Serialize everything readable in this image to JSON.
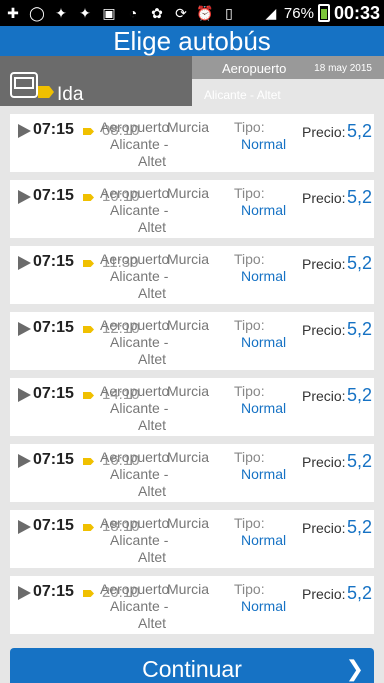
{
  "status_bar": {
    "battery_percent": "76%",
    "clock": "00:33",
    "icons": [
      "plus-icon",
      "whatsapp-icon",
      "twitter-icon",
      "twitter-icon",
      "image-icon",
      "wifi-icon",
      "settings-icon",
      "sync-icon",
      "alarm-icon",
      "vibrate-icon",
      "signal-icon",
      "battery-icon"
    ]
  },
  "title": "Elige autobús",
  "header": {
    "direction_label": "Ida",
    "origin": "Aeropuerto",
    "date": "18 may 2015",
    "destination": "Alicante - Altet"
  },
  "trips": [
    {
      "time": "07:15",
      "arrival": "08:10",
      "origin_l1": "Aeropuerto",
      "origin_l2": "Alicante -",
      "origin_l3": "Altet",
      "destination": "Murcia",
      "tipo_label": "Tipo:",
      "tipo_value": "Normal",
      "precio_label": "Precio:",
      "precio_value": "5,2"
    },
    {
      "time": "07:15",
      "arrival": "10:10",
      "origin_l1": "Aeropuerto",
      "origin_l2": "Alicante -",
      "origin_l3": "Altet",
      "destination": "Murcia",
      "tipo_label": "Tipo:",
      "tipo_value": "Normal",
      "precio_label": "Precio:",
      "precio_value": "5,2"
    },
    {
      "time": "07:15",
      "arrival": "11:30",
      "origin_l1": "Aeropuerto",
      "origin_l2": "Alicante -",
      "origin_l3": "Altet",
      "destination": "Murcia",
      "tipo_label": "Tipo:",
      "tipo_value": "Normal",
      "precio_label": "Precio:",
      "precio_value": "5,2"
    },
    {
      "time": "07:15",
      "arrival": "12:10",
      "origin_l1": "Aeropuerto",
      "origin_l2": "Alicante -",
      "origin_l3": "Altet",
      "destination": "Murcia",
      "tipo_label": "Tipo:",
      "tipo_value": "Normal",
      "precio_label": "Precio:",
      "precio_value": "5,2"
    },
    {
      "time": "07:15",
      "arrival": "14:10",
      "origin_l1": "Aeropuerto",
      "origin_l2": "Alicante -",
      "origin_l3": "Altet",
      "destination": "Murcia",
      "tipo_label": "Tipo:",
      "tipo_value": "Normal",
      "precio_label": "Precio:",
      "precio_value": "5,2"
    },
    {
      "time": "07:15",
      "arrival": "16:10",
      "origin_l1": "Aeropuerto",
      "origin_l2": "Alicante -",
      "origin_l3": "Altet",
      "destination": "Murcia",
      "tipo_label": "Tipo:",
      "tipo_value": "Normal",
      "precio_label": "Precio:",
      "precio_value": "5,2"
    },
    {
      "time": "07:15",
      "arrival": "18:10",
      "origin_l1": "Aeropuerto",
      "origin_l2": "Alicante -",
      "origin_l3": "Altet",
      "destination": "Murcia",
      "tipo_label": "Tipo:",
      "tipo_value": "Normal",
      "precio_label": "Precio:",
      "precio_value": "5,2"
    },
    {
      "time": "07:15",
      "arrival": "20:10",
      "origin_l1": "Aeropuerto",
      "origin_l2": "Alicante -",
      "origin_l3": "Altet",
      "destination": "Murcia",
      "tipo_label": "Tipo:",
      "tipo_value": "Normal",
      "precio_label": "Precio:",
      "precio_value": "5,2"
    }
  ],
  "continue_button": {
    "label": "Continuar"
  },
  "colors": {
    "accent": "#1672c4",
    "header_gray": "#6b6b6b",
    "tag_yellow": "#f0c000"
  }
}
